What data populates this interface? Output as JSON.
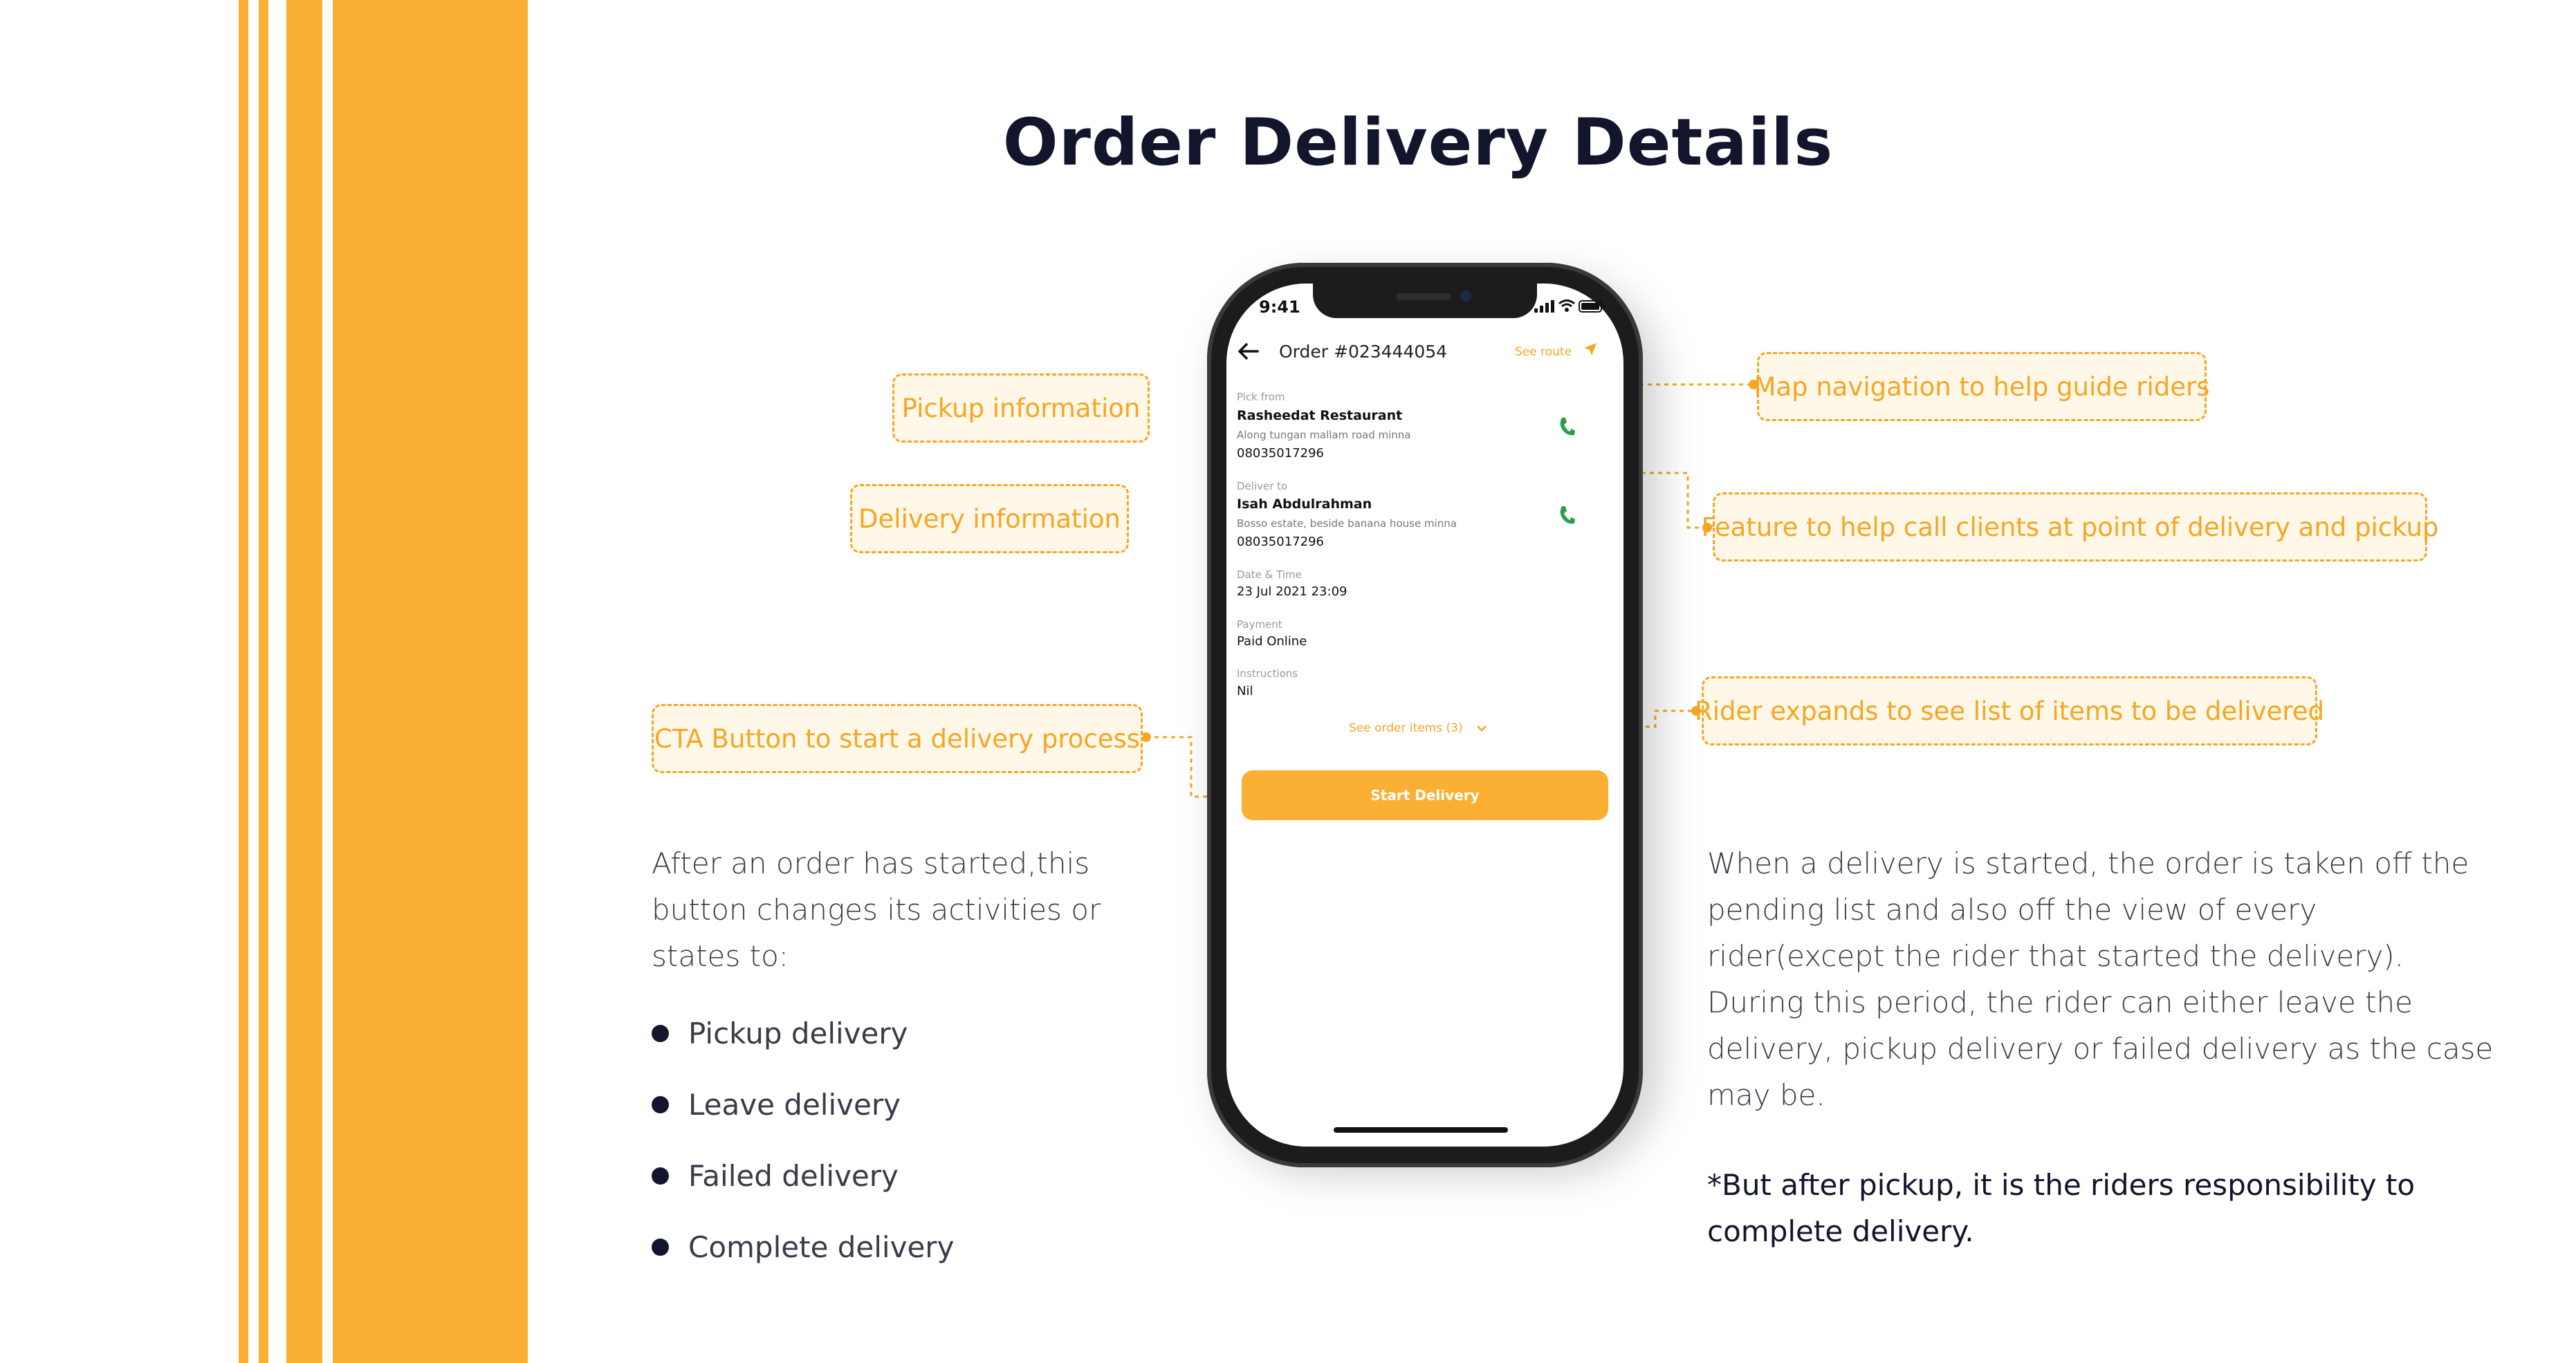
{
  "title": "Order Delivery Details",
  "callouts": {
    "pickup": "Pickup information",
    "delivery": "Delivery information",
    "cta": "CTA Button to start a delivery process",
    "map": "Map navigation to help guide riders",
    "call": "Feature to help call clients at point of delivery and pickup",
    "expand": "Rider expands to see list of items to be delivered"
  },
  "left_text": {
    "line1": "After an order has started,this",
    "line2": "button changes its activities or",
    "line3": "states to:"
  },
  "bullets": [
    "Pickup delivery",
    "Leave delivery",
    "Failed delivery",
    "Complete delivery"
  ],
  "right_text": {
    "line1": "When a delivery is started, the order is taken off the",
    "line2": "pending list and also off the view of every",
    "line3": "rider(except the rider that started the delivery).",
    "line4": "During this period, the rider can either leave the",
    "line5": "delivery, pickup delivery or failed delivery as the case",
    "line6": "may be.",
    "note1": "*But after pickup, it is the riders responsibility to",
    "note2": "complete delivery."
  },
  "phone": {
    "time": "9:41",
    "order_title": "Order #023444054",
    "see_route": "See route",
    "pickup_label": "Pick from",
    "pickup_name": "Rasheedat Restaurant",
    "pickup_address": "Along tungan mallam road minna",
    "pickup_phone": "08035017296",
    "deliver_label": "Deliver to",
    "deliver_name": "Isah Abdulrahman",
    "deliver_address": "Bosso estate, beside banana house minna",
    "deliver_phone": "08035017296",
    "date_label": "Date & Time",
    "date_value": "23 Jul 2021 23:09",
    "payment_label": "Payment",
    "payment_value": "Paid Online",
    "instructions_label": "Instructions",
    "instructions_value": "Nil",
    "see_items": "See order items (3)",
    "start_button": "Start Delivery"
  },
  "colors": {
    "accent": "#FBB034",
    "callout_text": "#F5A623",
    "call_green": "#2E9D4A",
    "title": "#12152b"
  },
  "icons": [
    "back-arrow-icon",
    "navigation-arrow-icon",
    "phone-icon",
    "chevron-down-icon",
    "signal-icon",
    "wifi-icon",
    "battery-icon"
  ]
}
